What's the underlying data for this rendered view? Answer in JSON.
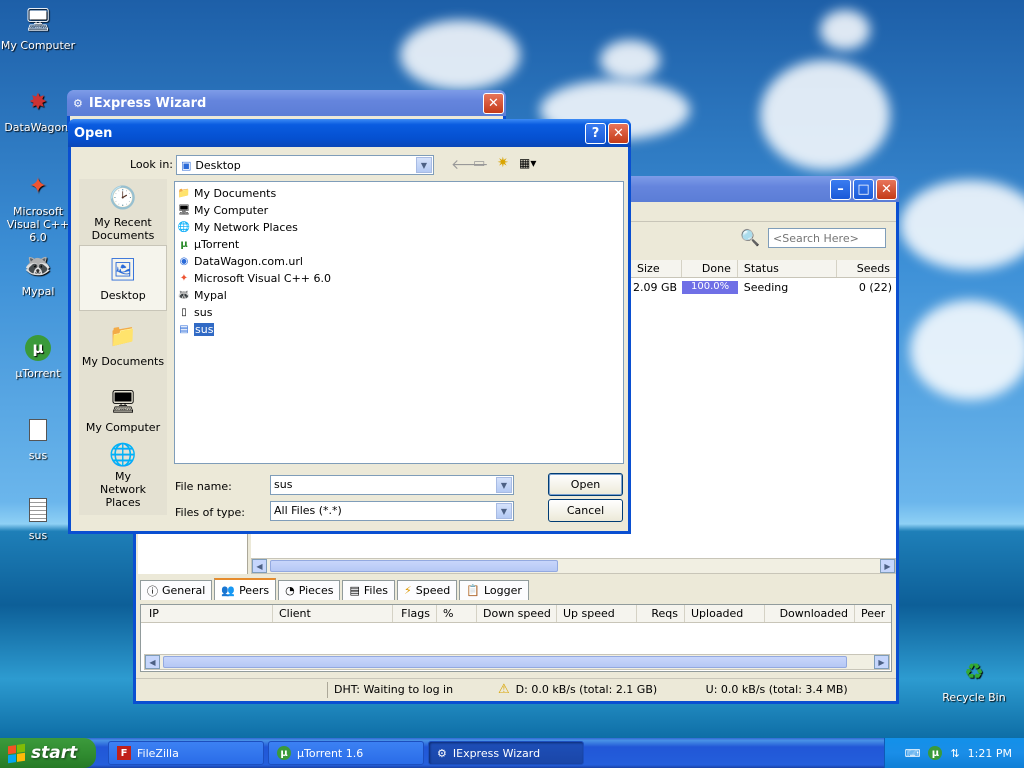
{
  "desktop": {
    "icons": [
      {
        "label": "My Computer"
      },
      {
        "label": "DataWagon."
      },
      {
        "label": "Microsoft Visual C++ 6.0"
      },
      {
        "label": "Mypal"
      },
      {
        "label": "µTorrent"
      },
      {
        "label": "sus"
      },
      {
        "label": "sus"
      },
      {
        "label": "Recycle Bin"
      }
    ]
  },
  "iexpress": {
    "title": "IExpress Wizard"
  },
  "utorrent": {
    "search_placeholder": "<Search Here>",
    "torrent_columns": [
      "Size",
      "Done",
      "Status",
      "Seeds"
    ],
    "torrent_row": {
      "size": "2.09 GB",
      "done": "100.0%",
      "done_fraction": 1.0,
      "status": "Seeding",
      "seeds": "0 (22)"
    },
    "tabs": [
      {
        "label": "General"
      },
      {
        "label": "Peers"
      },
      {
        "label": "Pieces"
      },
      {
        "label": "Files"
      },
      {
        "label": "Speed"
      },
      {
        "label": "Logger"
      }
    ],
    "peer_columns": [
      "IP",
      "Client",
      "Flags",
      "%",
      "Down speed",
      "Up speed",
      "Reqs",
      "Uploaded",
      "Downloaded",
      "Peer"
    ],
    "status": {
      "dht": "DHT: Waiting to log in",
      "down": "D: 0.0 kB/s (total: 2.1 GB)",
      "up": "U: 0.0 kB/s (total: 3.4 MB)"
    }
  },
  "open_dialog": {
    "title": "Open",
    "look_in_label": "Look in:",
    "look_in_value": "Desktop",
    "places": [
      {
        "label": "My Recent Documents"
      },
      {
        "label": "Desktop"
      },
      {
        "label": "My Documents"
      },
      {
        "label": "My Computer"
      },
      {
        "label": "My Network Places"
      }
    ],
    "files": [
      {
        "name": "My Documents"
      },
      {
        "name": "My Computer"
      },
      {
        "name": "My Network Places"
      },
      {
        "name": "µTorrent"
      },
      {
        "name": "DataWagon.com.url"
      },
      {
        "name": "Microsoft Visual C++ 6.0"
      },
      {
        "name": "Mypal"
      },
      {
        "name": "sus"
      },
      {
        "name": "sus"
      }
    ],
    "file_name_label": "File name:",
    "file_name_value": "sus",
    "files_of_type_label": "Files of type:",
    "files_of_type_value": "All Files (*.*)",
    "open_label": "Open",
    "cancel_label": "Cancel"
  },
  "taskbar": {
    "start_label": "start",
    "tasks": [
      {
        "label": "FileZilla"
      },
      {
        "label": "µTorrent 1.6"
      },
      {
        "label": "IExpress Wizard"
      }
    ],
    "clock": "1:21 PM"
  }
}
